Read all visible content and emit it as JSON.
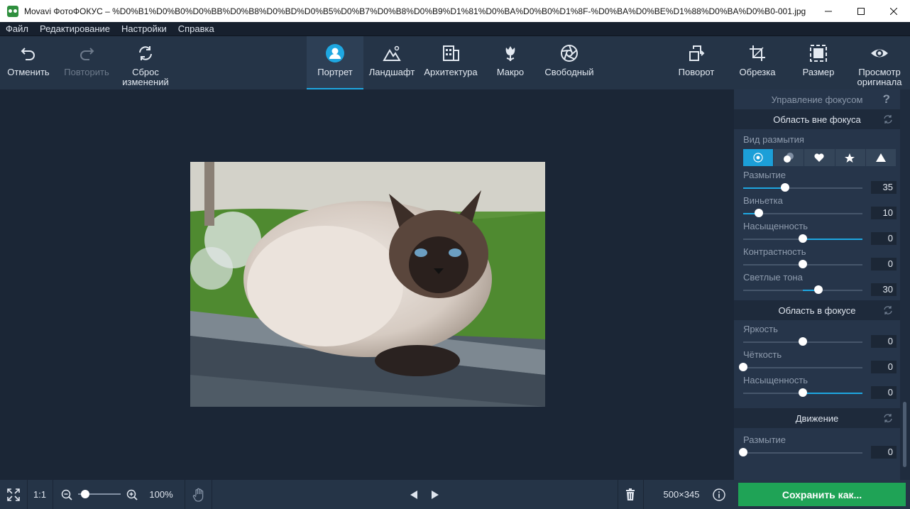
{
  "window": {
    "title": "Movavi ФотоФОКУС – %D0%B1%D0%B0%D0%BB%D0%B8%D0%BD%D0%B5%D0%B7%D0%B8%D0%B9%D1%81%D0%BA%D0%B0%D1%8F-%D0%BA%D0%BE%D1%88%D0%BA%D0%B0-001.jpg"
  },
  "menu": [
    "Файл",
    "Редактирование",
    "Настройки",
    "Справка"
  ],
  "toolbar": {
    "undo": "Отменить",
    "redo": "Повторить",
    "reset_line1": "Сброс",
    "reset_line2": "изменений",
    "portrait": "Портрет",
    "landscape": "Ландшафт",
    "architecture": "Архитектура",
    "macro": "Макро",
    "free": "Свободный",
    "rotate": "Поворот",
    "crop": "Обрезка",
    "resize": "Размер",
    "preview_line1": "Просмотр",
    "preview_line2": "оригинала"
  },
  "panel": {
    "focus_control": "Управление фокусом",
    "help": "?",
    "out_of_focus": {
      "title": "Область вне фокуса",
      "blur_type_label": "Вид размытия",
      "blur_types": [
        {
          "name": "circle",
          "selected": true
        },
        {
          "name": "bokeh-circles",
          "selected": false
        },
        {
          "name": "hearts",
          "selected": false
        },
        {
          "name": "stars",
          "selected": false
        },
        {
          "name": "triangles",
          "selected": false
        }
      ],
      "blur": {
        "label": "Размытие",
        "value": "35",
        "fraction": 0.35
      },
      "vignette": {
        "label": "Виньетка",
        "value": "10",
        "fraction": 0.13
      },
      "saturation": {
        "label": "Насыщенность",
        "value": "0",
        "fraction": 0.5
      },
      "contrast": {
        "label": "Контрастность",
        "value": "0",
        "fraction": 0.5
      },
      "highlights": {
        "label": "Светлые тона",
        "value": "30",
        "fraction": 0.63
      }
    },
    "in_focus": {
      "title": "Область в фокусе",
      "brightness": {
        "label": "Яркость",
        "value": "0",
        "fraction": 0.5
      },
      "sharpness": {
        "label": "Чёткость",
        "value": "0",
        "fraction": 0.0
      },
      "saturation": {
        "label": "Насыщенность",
        "value": "0",
        "fraction": 0.5
      }
    },
    "motion": {
      "title": "Движение",
      "blur": {
        "label": "Размытие",
        "value": "0",
        "fraction": 0.0
      }
    }
  },
  "bottombar": {
    "one_to_one": "1:1",
    "zoom": "100%",
    "image_size": "500×345",
    "save": "Сохранить как..."
  },
  "colors": {
    "accent": "#1ea7e1",
    "save": "#1fa356",
    "panel": "#26354a"
  }
}
